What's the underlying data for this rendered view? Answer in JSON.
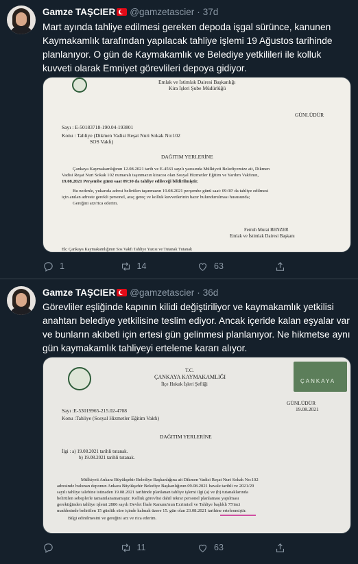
{
  "tweets": [
    {
      "name": "Gamze TAŞCIER",
      "handle": "@gamzetascier",
      "dot": "·",
      "time": "37d",
      "text": "Mart ayında tahliye edilmesi gereken depoda işgal sürünce, kanunen Kaymakamlık tarafından yapılacak tahliye işlemi 19 Ağustos tarihinde planlanıyor. O gün de Kaymakamlık ve Belediye yetkilileri ile kolluk kuvveti olarak Emniyet görevlileri depoya gidiyor.",
      "doc": {
        "header_line1": "Emlak ve İstimlak Dairesi Başkanlığı",
        "header_line2": "Kira İşleri Şube Müdürlüğü",
        "urgency": "GÜNLÜDÜR",
        "sayi": "Sayı   :  E-50183718-190.04-193801",
        "konu": "Konu  :  Tahliye (Dikmen Vadisi Reşat Nuri Sokak No:102",
        "konu2": "SOS Vakfı)",
        "dagitim": "DAĞITIM YERLERİNE",
        "p1a": "Çankaya Kaymakamlığının 12.08.2021 tarih ve E-4563 sayılı yazısında Mülkiyeti Belediyemize ait, Dikmen",
        "p1b": "Vadisi Reşat Nuri Sokak 102 numaralı taşınmazın kiracısı olan Sosyal Hizmetler Eğitim ve Yardım Vakfının,",
        "p1c": "19.08.2021 Perşembe günü saat 09:30 da tahliye edileceği bildirilmiştir.",
        "p2a": "Bu nedenle, yukarıda adresi belirtilen taşınmazın 19.08.2021 perşembe günü saat: 09:30' da tahliye edilmesi",
        "p2b": "için anılan adreste gerekli personel, araç gereç ve kolluk kuvvetlerinin hazır bulundurulması hususunda;",
        "p2c": "Gereğini arz/rica ederim.",
        "signer": "Ferruh Murat BENZER",
        "signer_title": "Emlak ve İstimlak Dairesi Başkanı",
        "ek": "Ek: Çankaya Kaymakamlığının Sos Vakfı Tahliye Yazısı ve Tutanak Tutanak"
      },
      "replies": "1",
      "retweets": "14",
      "likes": "63"
    },
    {
      "name": "Gamze TAŞCIER",
      "handle": "@gamzetascier",
      "dot": "·",
      "time": "36d",
      "text": "Görevliler eşliğinde kapının kilidi değiştiriliyor ve kaymakamlık yetkilisi anahtarı belediye yetkilisine teslim ediyor. Ancak içeride kalan eşyalar var ve bunların akıbeti için ertesi gün gelinmesi planlanıyor. Ne hikmetse aynı gün kaymakamlık tahliyeyi erteleme kararı alıyor.",
      "doc": {
        "tc": "T.C.",
        "kaymakamlik": "ÇANKAYA KAYMAKAMLIĞI",
        "mudurluk": "İlçe Hukuk İşleri Şefliği",
        "logo_text": "ÇANKAYA",
        "urgency": "GÜNLÜDÜR",
        "date": "19.08.2021",
        "sayi": "Sayı    :E-53019965-215.02-4708",
        "konu": "Konu  :Tahliye (Sosyal Hizmetler Eğitim Vakfı)",
        "dagitim": "DAĞITIM YERLERİNE",
        "ilgi": "İlgi :   a) 19.08.2021 tarihli tutanak.",
        "ilgi_b": "b) 19.08.2021 tarihli tutanak.",
        "p1": "Mülkiyeti Ankara Büyükşehir Belediye Başkanlığına ait Dikmen Vadisi Reşat Nuri Sokak No:102",
        "p2": "adresinde bulunan deponun Ankara Büyükşehir Belediye Başkanlığının 09.08.2021 havale tarihli ve 2021/29",
        "p3": "sayılı tahliye talebine istinaden 19.08.2021 tarihinde planlanan tahliye işlemi ilgi (a) ve (b) tutanaklarında",
        "p4": "belirtilen sebeplerle tamamlanamamıştır. Kolluk görevlisi dahil tekrar personel planlaması yapılması",
        "p5": "gerektiğinden tahliye işlemi 2886 sayılı Devlet İhale Kanunu'nun Ecrimisil ve Tahliye başlıklı 75'inci",
        "p6": "maddesinde belirtilen 15 günlük süre içinde kalmak üzere 15. gün olan 23.08.2021 tarihine ertelenmiştir.",
        "p7": "Bilgi edinilmesini ve gereğini arz ve rica ederim."
      },
      "replies": "",
      "retweets": "11",
      "likes": "63"
    }
  ]
}
